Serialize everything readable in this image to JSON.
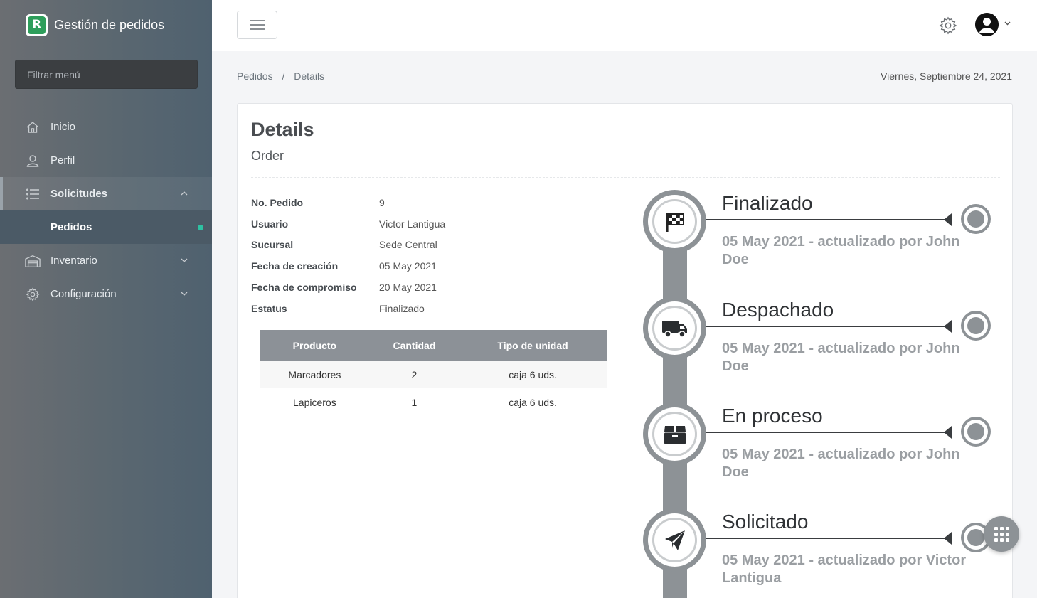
{
  "app": {
    "title": "Gestión de pedidos",
    "logo_letter": "R"
  },
  "sidebar": {
    "filter_placeholder": "Filtrar menú",
    "items": [
      {
        "label": "Inicio",
        "icon": "home-icon"
      },
      {
        "label": "Perfil",
        "icon": "user-icon"
      },
      {
        "label": "Solicitudes",
        "icon": "list-icon",
        "expanded": true
      },
      {
        "label": "Pedidos",
        "sub": true,
        "active": true
      },
      {
        "label": "Inventario",
        "icon": "warehouse-icon"
      },
      {
        "label": "Configuración",
        "icon": "gear-icon"
      }
    ]
  },
  "header": {
    "icons": [
      "menu-icon",
      "gear-icon",
      "user-avatar-icon",
      "chevron-down-icon"
    ]
  },
  "breadcrumb": {
    "parent": "Pedidos",
    "separator": "/",
    "current": "Details"
  },
  "date": "Viernes, Septiembre 24, 2021",
  "card": {
    "title": "Details",
    "subtitle": "Order"
  },
  "order": {
    "labels": {
      "number": "No. Pedido",
      "user": "Usuario",
      "branch": "Sucursal",
      "created": "Fecha de creación",
      "commitment": "Fecha de compromiso",
      "status": "Estatus"
    },
    "values": {
      "number": "9",
      "user": "Victor Lantigua",
      "branch": "Sede Central",
      "created": "05 May 2021",
      "commitment": "20 May 2021",
      "status": "Finalizado"
    }
  },
  "items_table": {
    "headers": [
      "Producto",
      "Cantidad",
      "Tipo de unidad"
    ],
    "rows": [
      [
        "Marcadores",
        "2",
        "caja 6 uds."
      ],
      [
        "Lapiceros",
        "1",
        "caja 6 uds."
      ]
    ]
  },
  "timeline": [
    {
      "title": "Finalizado",
      "meta": "05 May 2021 - actualizado por John Doe",
      "icon": "checkered-flag-icon"
    },
    {
      "title": "Despachado",
      "meta": "05 May 2021 - actualizado por John Doe",
      "icon": "truck-icon"
    },
    {
      "title": "En proceso",
      "meta": "05 May 2021 - actualizado por John Doe",
      "icon": "box-icon"
    },
    {
      "title": "Solicitado",
      "meta": "05 May 2021 - actualizado por Victor Lantigua",
      "icon": "paper-plane-icon"
    }
  ],
  "colors": {
    "accent_green": "#2e9e5b",
    "timeline_gray": "#8d9296",
    "active_dot": "#2ec1a2"
  }
}
